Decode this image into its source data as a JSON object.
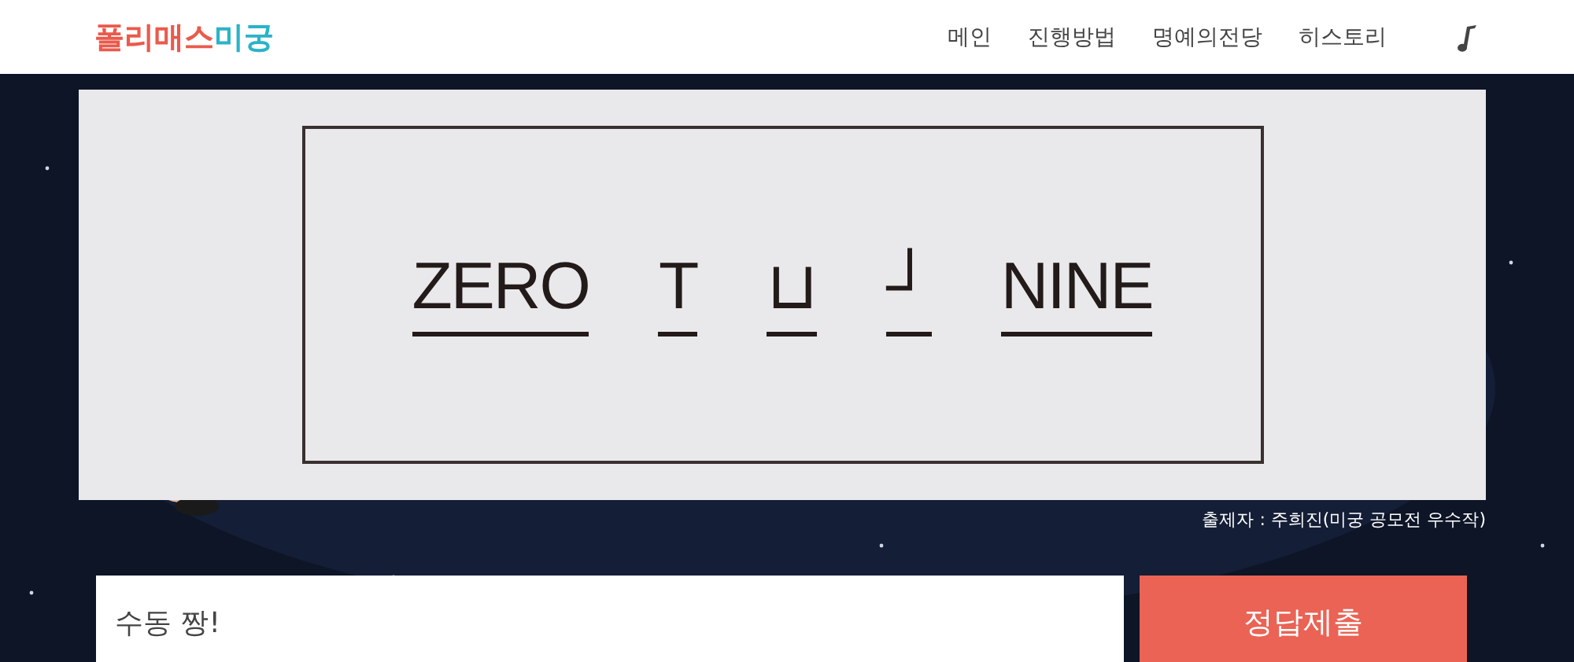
{
  "header": {
    "logo": {
      "first": "폴리매스",
      "second": "미궁"
    },
    "nav": [
      {
        "label": "메인"
      },
      {
        "label": "진행방법"
      },
      {
        "label": "명예의전당"
      },
      {
        "label": "히스토리"
      }
    ]
  },
  "puzzle": {
    "words": [
      "ZERO",
      "T",
      "⊔",
      "┘",
      "NINE"
    ],
    "credit": "출제자 : 주희진(미궁 공모전 우수작)"
  },
  "answer": {
    "value": "수동 짱!",
    "submit": "정답제출"
  }
}
